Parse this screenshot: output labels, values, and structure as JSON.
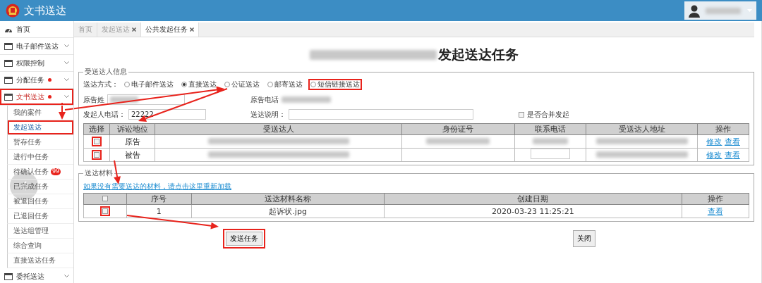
{
  "header": {
    "title": "文书送达"
  },
  "sidebar": {
    "items": [
      {
        "kind": "link",
        "label": "首页",
        "dot": false,
        "selected": false,
        "highlighted": false
      },
      {
        "kind": "menu",
        "label": "电子邮件送达",
        "dot": false,
        "selected": false,
        "highlighted": false
      },
      {
        "kind": "menu",
        "label": "权限控制",
        "dot": false,
        "selected": false,
        "highlighted": false
      },
      {
        "kind": "menu",
        "label": "分配任务",
        "dot": true,
        "selected": false,
        "highlighted": false
      },
      {
        "kind": "menu",
        "label": "文书送达",
        "dot": true,
        "selected": true,
        "highlighted": true,
        "children": [
          {
            "label": "我的案件",
            "selected": false,
            "highlighted": false
          },
          {
            "label": "发起送达",
            "selected": true,
            "highlighted": true
          },
          {
            "label": "暂存任务",
            "selected": false,
            "highlighted": false
          },
          {
            "label": "进行中任务",
            "selected": false,
            "highlighted": false
          },
          {
            "label": "待确认任务",
            "badge": "99",
            "selected": false,
            "highlighted": false
          },
          {
            "label": "已完成任务",
            "selected": false,
            "highlighted": false
          },
          {
            "label": "被退回任务",
            "selected": false,
            "highlighted": false
          },
          {
            "label": "已退回任务",
            "selected": false,
            "highlighted": false
          },
          {
            "label": "送达组管理",
            "selected": false,
            "highlighted": false
          },
          {
            "label": "综合查询",
            "selected": false,
            "highlighted": false
          },
          {
            "label": "直接送达任务",
            "selected": false,
            "highlighted": false
          }
        ]
      },
      {
        "kind": "menu",
        "label": "委托送达",
        "dot": false,
        "selected": false,
        "highlighted": false
      }
    ]
  },
  "tabs": [
    {
      "label": "首页",
      "closable": false,
      "selected": false
    },
    {
      "label": "发起送达",
      "closable": true,
      "selected": false
    },
    {
      "label": "公共发起任务",
      "closable": true,
      "selected": true
    }
  ],
  "page_title": "发起送达任务",
  "recipient_info": {
    "legend": "受送达人信息",
    "delivery_method": {
      "label": "送达方式：",
      "options": [
        {
          "label": "电子邮件送达",
          "selected": false,
          "highlighted": false
        },
        {
          "label": "直接送达",
          "selected": true,
          "highlighted": false
        },
        {
          "label": "公证送达",
          "selected": false,
          "highlighted": false
        },
        {
          "label": "邮寄送达",
          "selected": false,
          "highlighted": false
        },
        {
          "label": "短信链接送达",
          "selected": false,
          "highlighted": true
        }
      ]
    },
    "plaintiff_name": {
      "label": "原告姓",
      "blurred": true
    },
    "plaintiff_phone": {
      "label": "原告电话",
      "blurred": true
    },
    "sender_phone": {
      "label": "发起人电话：",
      "value": "22222"
    },
    "delivery_note": {
      "label": "送达说明："
    },
    "merge": {
      "label": "是否合并发起",
      "checked": false
    },
    "table": {
      "columns": [
        "选择",
        "诉讼地位",
        "受送达人",
        "身份证号",
        "联系电话",
        "受送达人地址",
        "操作"
      ],
      "rows": [
        {
          "checked": false,
          "highlighted": true,
          "role": "原告",
          "name_blurred": true,
          "id_blurred": true,
          "phone_blurred": true,
          "phone_field": false,
          "address_blurred": true,
          "actions": [
            "修改",
            "查看"
          ]
        },
        {
          "checked": false,
          "highlighted": true,
          "role": "被告",
          "name_blurred": true,
          "id_blurred": false,
          "phone_blurred": false,
          "phone_field": true,
          "address_blurred": true,
          "actions": [
            "修改",
            "查看"
          ]
        }
      ]
    }
  },
  "materials": {
    "legend": "送达材料",
    "reload_link": "如果没有需要送达的材料，请点击这里重新加载",
    "table": {
      "header_checked": false,
      "columns": [
        "序号",
        "送达材料名称",
        "创建日期",
        "操作"
      ],
      "rows": [
        {
          "checked": false,
          "highlighted": true,
          "index": "1",
          "name": "起诉状.jpg",
          "created": "2020-03-23 11:25:21",
          "action": "查看"
        }
      ]
    }
  },
  "buttons": [
    {
      "label": "发送任务",
      "highlighted": true
    },
    {
      "label": "关闭",
      "highlighted": false
    }
  ]
}
